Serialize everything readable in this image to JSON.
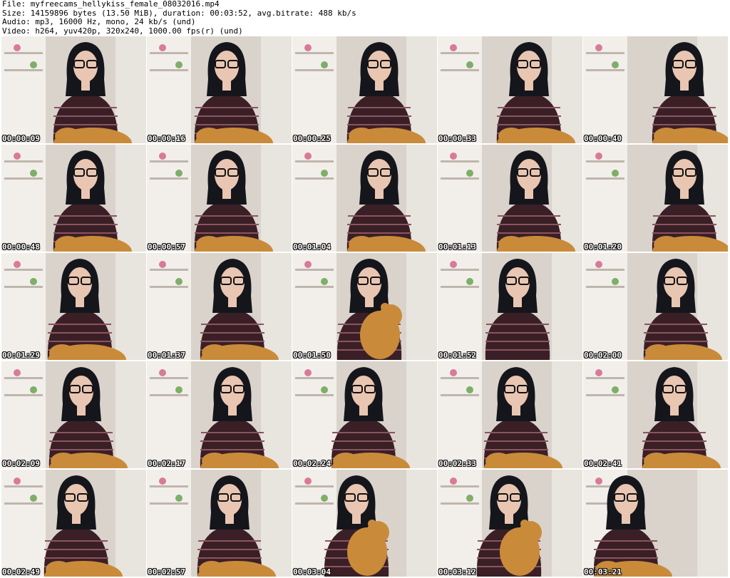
{
  "header": {
    "file": "File: myfreecams_hellykiss_female_08032016.mp4",
    "size": "Size: 14159896 bytes (13.50 MiB), duration: 00:03:52, avg.bitrate: 488 kb/s",
    "audio": "Audio: mp3, 16000 Hz, mono, 24 kb/s (und)",
    "video": "Video: h264, yuv420p, 320x240, 1000.00 fps(r) (und)"
  },
  "colors": {
    "background": "#ffffff",
    "wall": "#d9d3cc",
    "shelf": "#f2efea",
    "hair": "#15161c",
    "skin": "#e9c6b2",
    "sweater": "#3b1f26",
    "stripe": "#8a5560",
    "teddy": "#c98b3a",
    "timestamp": "#ffffff"
  },
  "thumbnails": [
    {
      "time": "00:00:09"
    },
    {
      "time": "00:00:16"
    },
    {
      "time": "00:00:25"
    },
    {
      "time": "00:00:33"
    },
    {
      "time": "00:00:40"
    },
    {
      "time": "00:00:48"
    },
    {
      "time": "00:00:57"
    },
    {
      "time": "00:01:04"
    },
    {
      "time": "00:01:13"
    },
    {
      "time": "00:01:20"
    },
    {
      "time": "00:01:29"
    },
    {
      "time": "00:01:37"
    },
    {
      "time": "00:01:50"
    },
    {
      "time": "00:01:52"
    },
    {
      "time": "00:02:00"
    },
    {
      "time": "00:02:09"
    },
    {
      "time": "00:02:17"
    },
    {
      "time": "00:02:24"
    },
    {
      "time": "00:02:33"
    },
    {
      "time": "00:02:41"
    },
    {
      "time": "00:02:49"
    },
    {
      "time": "00:02:57"
    },
    {
      "time": "00:03:04"
    },
    {
      "time": "00:03:12"
    },
    {
      "time": "00:03:21"
    }
  ]
}
